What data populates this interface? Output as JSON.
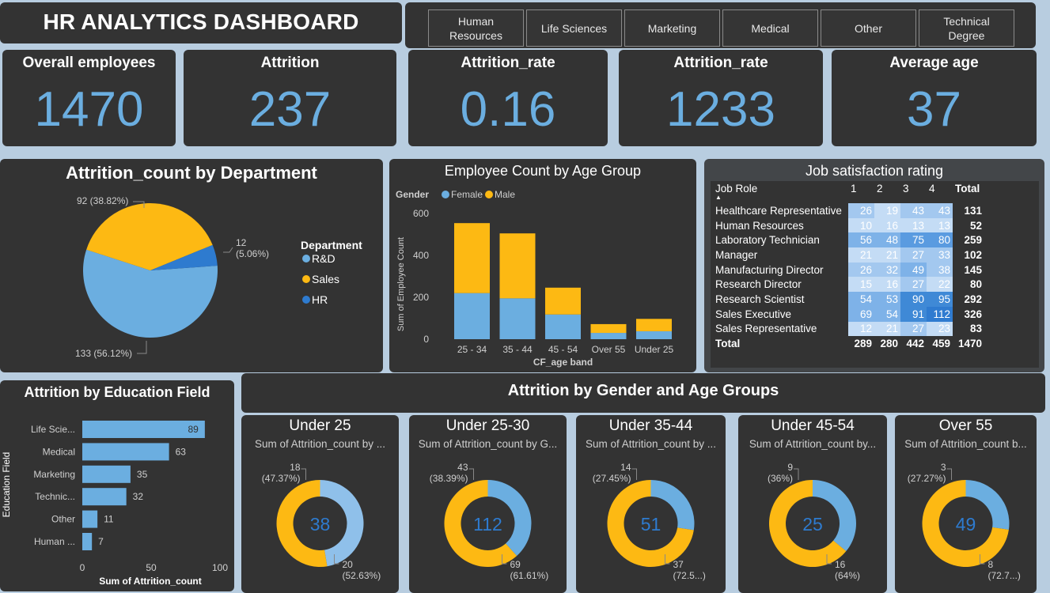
{
  "title": "HR ANALYTICS DASHBOARD",
  "slicer": [
    "Human\nResources",
    "Life Sciences",
    "Marketing",
    "Medical",
    "Other",
    "Technical\nDegree"
  ],
  "kpis": [
    {
      "label": "Overall employees",
      "value": "1470"
    },
    {
      "label": "Attrition",
      "value": "237"
    },
    {
      "label": "Attrition_rate",
      "value": "0.16"
    },
    {
      "label": "Attrition_rate",
      "value": "1233"
    },
    {
      "label": "Average age",
      "value": "37"
    }
  ],
  "colors": {
    "blue": "#6baee0",
    "yellow": "#fdb913",
    "dark_blue": "#2e7bcf",
    "panel": "#333333",
    "bg": "#b8cde0"
  },
  "chart_data": [
    {
      "type": "pie",
      "title": "Attrition_count by Department",
      "legend_title": "Department",
      "legend_position": "right",
      "labels": [
        "R&D",
        "Sales",
        "HR"
      ],
      "values": [
        133,
        92,
        12
      ],
      "percent_labels": [
        "133 (56.12%)",
        "92 (38.82%)",
        "12\n(5.06%)"
      ],
      "colors": [
        "#6baee0",
        "#fdb913",
        "#2e7bcf"
      ]
    },
    {
      "type": "bar",
      "stacked": true,
      "title": "Employee Count by Age Group",
      "legend_title": "Gender",
      "legend_position": "top-left",
      "categories": [
        "25 - 34",
        "35 - 44",
        "45 - 54",
        "Over 55",
        "Under 25"
      ],
      "series": [
        {
          "name": "Female",
          "values": [
            220,
            195,
            118,
            30,
            38
          ]
        },
        {
          "name": "Male",
          "values": [
            334,
            310,
            128,
            42,
            59
          ]
        }
      ],
      "xlabel": "CF_age band",
      "ylabel": "Sum of Employee Count",
      "yticks": [
        "0",
        "200",
        "400",
        "600"
      ],
      "ylim": [
        0,
        650
      ]
    },
    {
      "type": "table",
      "title": "Job satisfaction rating",
      "columns": [
        "Job Role",
        "1",
        "2",
        "3",
        "4",
        "Total"
      ],
      "rows": [
        [
          "Healthcare Representative",
          "26",
          "19",
          "43",
          "43",
          "131"
        ],
        [
          "Human Resources",
          "10",
          "16",
          "13",
          "13",
          "52"
        ],
        [
          "Laboratory Technician",
          "56",
          "48",
          "75",
          "80",
          "259"
        ],
        [
          "Manager",
          "21",
          "21",
          "27",
          "33",
          "102"
        ],
        [
          "Manufacturing Director",
          "26",
          "32",
          "49",
          "38",
          "145"
        ],
        [
          "Research Director",
          "15",
          "16",
          "27",
          "22",
          "80"
        ],
        [
          "Research Scientist",
          "54",
          "53",
          "90",
          "95",
          "292"
        ],
        [
          "Sales Executive",
          "69",
          "54",
          "91",
          "112",
          "326"
        ],
        [
          "Sales Representative",
          "12",
          "21",
          "27",
          "23",
          "83"
        ]
      ],
      "total": [
        "Total",
        "289",
        "280",
        "442",
        "459",
        "1470"
      ]
    },
    {
      "type": "bar",
      "orientation": "horizontal",
      "title": "Attrition by Education Field",
      "categories": [
        "Life Scie...",
        "Medical",
        "Marketing",
        "Technic...",
        "Other",
        "Human ..."
      ],
      "values": [
        89,
        63,
        35,
        32,
        11,
        7
      ],
      "xlabel": "Sum of Attrition_count",
      "ylabel": "Education Field",
      "xticks": [
        "0",
        "50",
        "100"
      ],
      "xlim": [
        0,
        100
      ]
    },
    {
      "type": "pie",
      "donut": true,
      "group_title": "Attrition by Gender and Age Groups",
      "charts": [
        {
          "title": "Under 25",
          "subtitle": "Sum of Attrition_count by ...",
          "center": "38",
          "values": [
            18,
            20
          ],
          "label_a": "18\n(47.37%)",
          "label_b": "20\n(52.63%)"
        },
        {
          "title": "Under 25-30",
          "subtitle": "Sum of Attrition_count by G...",
          "center": "112",
          "values": [
            43,
            69
          ],
          "label_a": "43\n(38.39%)",
          "label_b": "69\n(61.61%)"
        },
        {
          "title": "Under 35-44",
          "subtitle": "Sum of Attrition_count by ...",
          "center": "51",
          "values": [
            14,
            37
          ],
          "label_a": "14\n(27.45%)",
          "label_b": "37\n(72.5...)"
        },
        {
          "title": "Under 45-54",
          "subtitle": "Sum of Attrition_count by...",
          "center": "25",
          "values": [
            9,
            16
          ],
          "label_a": "9\n(36%)",
          "label_b": "16\n(64%)"
        },
        {
          "title": "Over 55",
          "subtitle": "Sum of Attrition_count b...",
          "center": "49",
          "values": [
            3,
            8
          ],
          "label_a": "3\n(27.27%)",
          "label_b": "8\n(72.7...)"
        }
      ]
    }
  ]
}
